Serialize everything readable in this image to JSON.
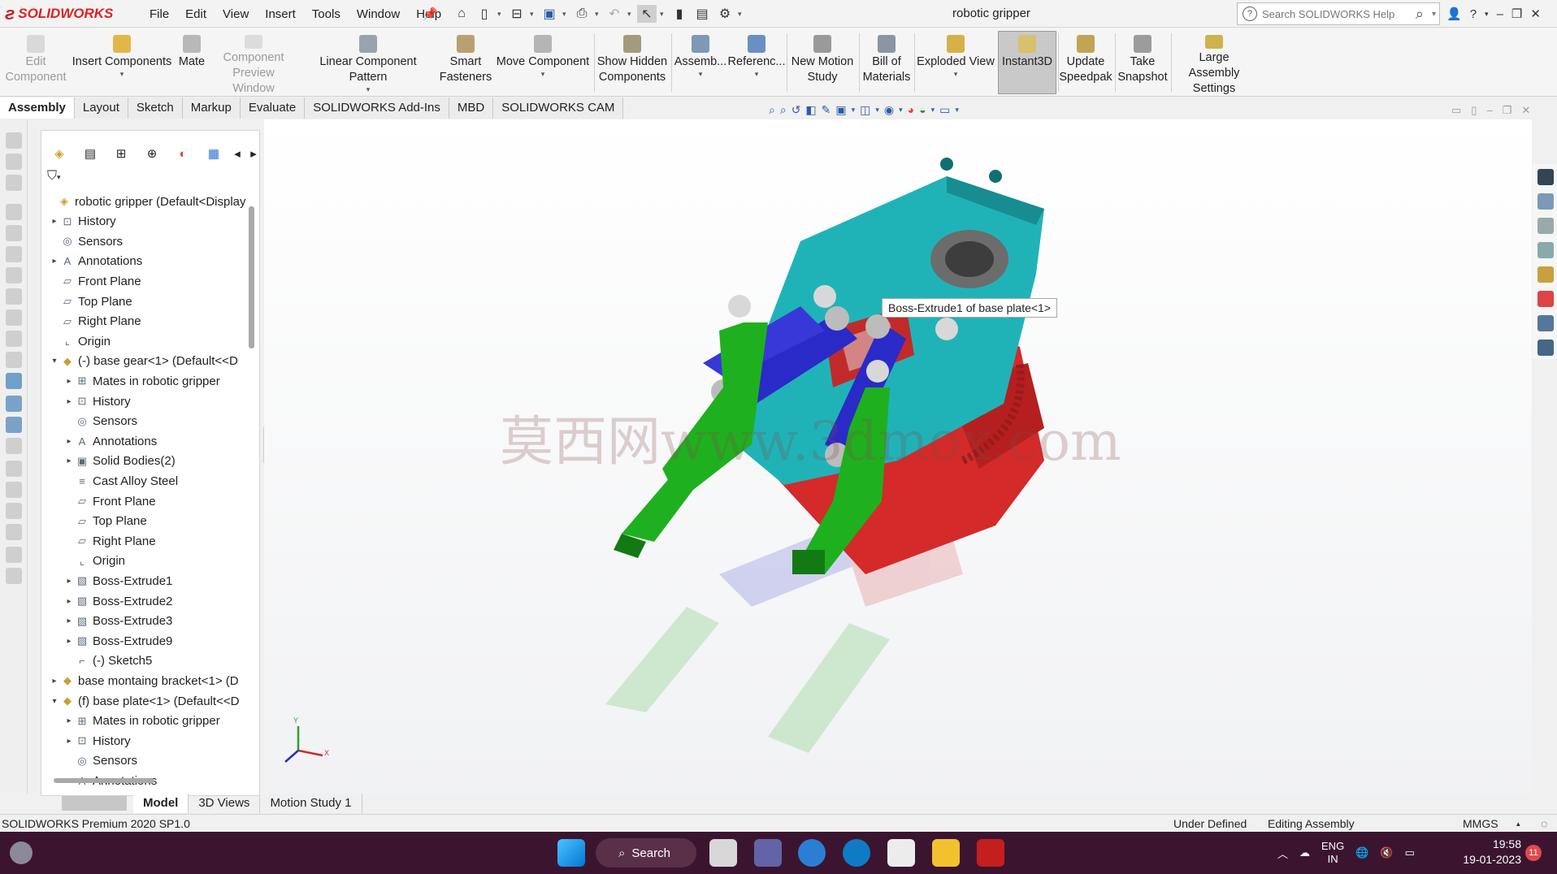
{
  "app": {
    "name": "SOLIDWORKS",
    "window_title": "robotic gripper",
    "search_placeholder": "Search SOLIDWORKS Help"
  },
  "menu": [
    "File",
    "Edit",
    "View",
    "Insert",
    "Tools",
    "Window",
    "Help"
  ],
  "commands": [
    {
      "label1": "Edit",
      "label2": "Component",
      "disabled": true
    },
    {
      "label1": "Insert Components",
      "label2": "",
      "disabled": false
    },
    {
      "label1": "Mate",
      "label2": "",
      "disabled": false
    },
    {
      "label1": "Component",
      "label2": "Preview Window",
      "disabled": true
    },
    {
      "label1": "Linear Component Pattern",
      "label2": "",
      "disabled": false
    },
    {
      "label1": "Smart",
      "label2": "Fasteners",
      "disabled": false
    },
    {
      "label1": "Move Component",
      "label2": "",
      "disabled": false
    },
    {
      "label1": "Show Hidden",
      "label2": "Components",
      "disabled": false
    },
    {
      "label1": "Assemb...",
      "label2": "",
      "disabled": false
    },
    {
      "label1": "Referenc...",
      "label2": "",
      "disabled": false
    },
    {
      "label1": "New Motion",
      "label2": "Study",
      "disabled": false
    },
    {
      "label1": "Bill of",
      "label2": "Materials",
      "disabled": false
    },
    {
      "label1": "Exploded View",
      "label2": "",
      "disabled": false
    },
    {
      "label1": "Instant3D",
      "label2": "",
      "disabled": false
    },
    {
      "label1": "Update",
      "label2": "Speedpak",
      "disabled": false
    },
    {
      "label1": "Take",
      "label2": "Snapshot",
      "disabled": false
    },
    {
      "label1": "Large Assembly",
      "label2": "Settings",
      "disabled": false
    }
  ],
  "tabs": [
    "Assembly",
    "Layout",
    "Sketch",
    "Markup",
    "Evaluate",
    "SOLIDWORKS Add-Ins",
    "MBD",
    "SOLIDWORKS CAM"
  ],
  "active_tab": "Assembly",
  "tree": [
    {
      "label": "robotic gripper  (Default<Display",
      "icon": "assembly-icon",
      "level": 0,
      "arrow": ""
    },
    {
      "label": "History",
      "icon": "history-icon",
      "level": 1,
      "arrow": "right"
    },
    {
      "label": "Sensors",
      "icon": "sensors-icon",
      "level": 1,
      "arrow": ""
    },
    {
      "label": "Annotations",
      "icon": "annotations-icon",
      "level": 1,
      "arrow": "right"
    },
    {
      "label": "Front Plane",
      "icon": "plane-icon",
      "level": 1,
      "arrow": ""
    },
    {
      "label": "Top Plane",
      "icon": "plane-icon",
      "level": 1,
      "arrow": ""
    },
    {
      "label": "Right Plane",
      "icon": "plane-icon",
      "level": 1,
      "arrow": ""
    },
    {
      "label": "Origin",
      "icon": "origin-icon",
      "level": 1,
      "arrow": ""
    },
    {
      "label": "(-) base gear<1> (Default<<D",
      "icon": "part-icon",
      "level": 1,
      "arrow": "down"
    },
    {
      "label": "Mates in robotic gripper",
      "icon": "mates-icon",
      "level": 2,
      "arrow": "right"
    },
    {
      "label": "History",
      "icon": "history-icon",
      "level": 2,
      "arrow": "right"
    },
    {
      "label": "Sensors",
      "icon": "sensors-icon",
      "level": 2,
      "arrow": ""
    },
    {
      "label": "Annotations",
      "icon": "annotations-icon",
      "level": 2,
      "arrow": "right"
    },
    {
      "label": "Solid Bodies(2)",
      "icon": "solid-bodies-icon",
      "level": 2,
      "arrow": "right"
    },
    {
      "label": "Cast Alloy Steel",
      "icon": "material-icon",
      "level": 2,
      "arrow": ""
    },
    {
      "label": "Front Plane",
      "icon": "plane-icon",
      "level": 2,
      "arrow": ""
    },
    {
      "label": "Top Plane",
      "icon": "plane-icon",
      "level": 2,
      "arrow": ""
    },
    {
      "label": "Right Plane",
      "icon": "plane-icon",
      "level": 2,
      "arrow": ""
    },
    {
      "label": "Origin",
      "icon": "origin-icon",
      "level": 2,
      "arrow": ""
    },
    {
      "label": "Boss-Extrude1",
      "icon": "extrude-icon",
      "level": 2,
      "arrow": "right"
    },
    {
      "label": "Boss-Extrude2",
      "icon": "extrude-icon",
      "level": 2,
      "arrow": "right"
    },
    {
      "label": "Boss-Extrude3",
      "icon": "extrude-icon",
      "level": 2,
      "arrow": "right"
    },
    {
      "label": "Boss-Extrude9",
      "icon": "extrude-icon",
      "level": 2,
      "arrow": "right"
    },
    {
      "label": "(-) Sketch5",
      "icon": "sketch-icon",
      "level": 2,
      "arrow": ""
    },
    {
      "label": "base montaing bracket<1> (D",
      "icon": "part-icon",
      "level": 1,
      "arrow": "right"
    },
    {
      "label": "(f) base plate<1> (Default<<D",
      "icon": "part-icon",
      "level": 1,
      "arrow": "down"
    },
    {
      "label": "Mates in robotic gripper",
      "icon": "mates-icon",
      "level": 2,
      "arrow": "right"
    },
    {
      "label": "History",
      "icon": "history-icon",
      "level": 2,
      "arrow": "right"
    },
    {
      "label": "Sensors",
      "icon": "sensors-icon",
      "level": 2,
      "arrow": ""
    },
    {
      "label": "Annotations",
      "icon": "annotations-icon",
      "level": 2,
      "arrow": "right"
    }
  ],
  "tooltip": "Boss-Extrude1 of base plate<1>",
  "watermark": "莫西网www.3dmox.com",
  "triad": {
    "x": "X",
    "y": "Y"
  },
  "bottom_tabs": [
    "Model",
    "3D Views",
    "Motion Study 1"
  ],
  "status": {
    "version": "SOLIDWORKS Premium 2020 SP1.0",
    "definition": "Under Defined",
    "mode": "Editing Assembly",
    "units": "MMGS"
  },
  "taskbar": {
    "search": "Search",
    "lang1": "ENG",
    "lang2": "IN",
    "time": "19:58",
    "date": "19-01-2023",
    "notifications": "11"
  },
  "colors": {
    "brand": "#d22020",
    "part_cyan": "#1fb3b8",
    "part_green": "#1fb01f",
    "part_blue": "#2a2ac8",
    "part_red": "#d42a2a",
    "taskbar": "#3b1530"
  }
}
